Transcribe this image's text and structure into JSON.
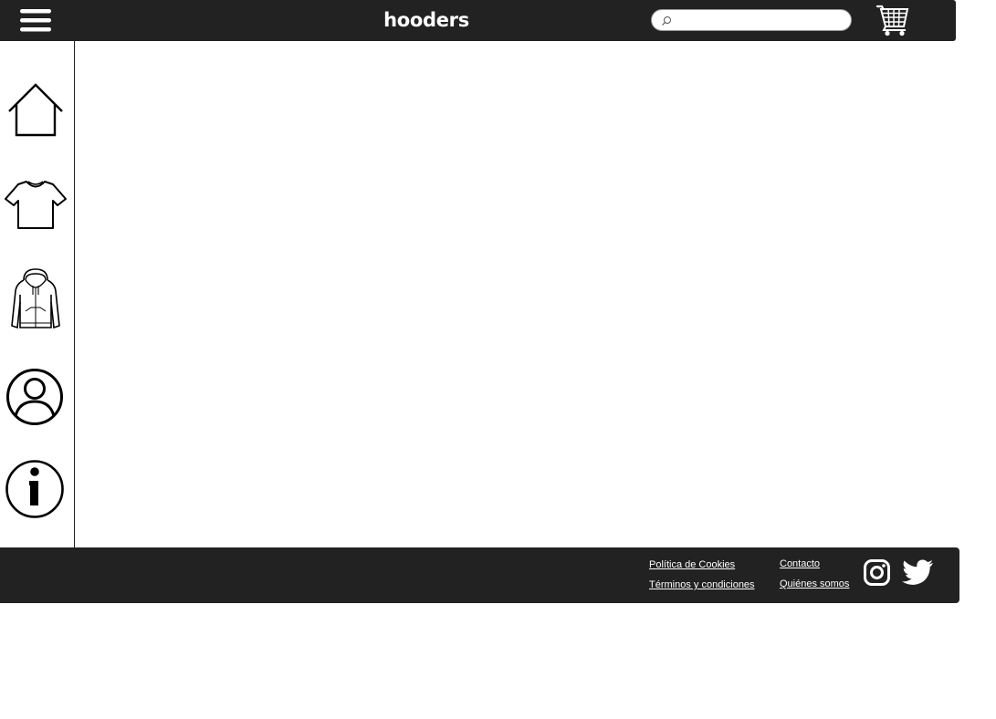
{
  "header": {
    "brand": "hooders",
    "search": {
      "placeholder": "",
      "value": ""
    },
    "menu_icon": "hamburger-menu-icon",
    "cart_icon": "shopping-cart-icon"
  },
  "sidebar": {
    "items": [
      {
        "name": "home",
        "icon": "house-icon"
      },
      {
        "name": "t-shirts",
        "icon": "tshirt-icon"
      },
      {
        "name": "hoodies",
        "icon": "hoodie-icon"
      },
      {
        "name": "account",
        "icon": "user-icon"
      },
      {
        "name": "info",
        "icon": "info-icon"
      }
    ]
  },
  "footer": {
    "links": {
      "cookies": "Política de Cookies ",
      "terms": "Términos y condiciones",
      "contact": "Contacto",
      "about": "Quiénes somos"
    },
    "social": [
      "instagram-icon",
      "twitter-icon"
    ]
  },
  "colors": {
    "bar": "#222222",
    "text_on_bar": "#ffffff",
    "icon_stroke": "#000000"
  }
}
